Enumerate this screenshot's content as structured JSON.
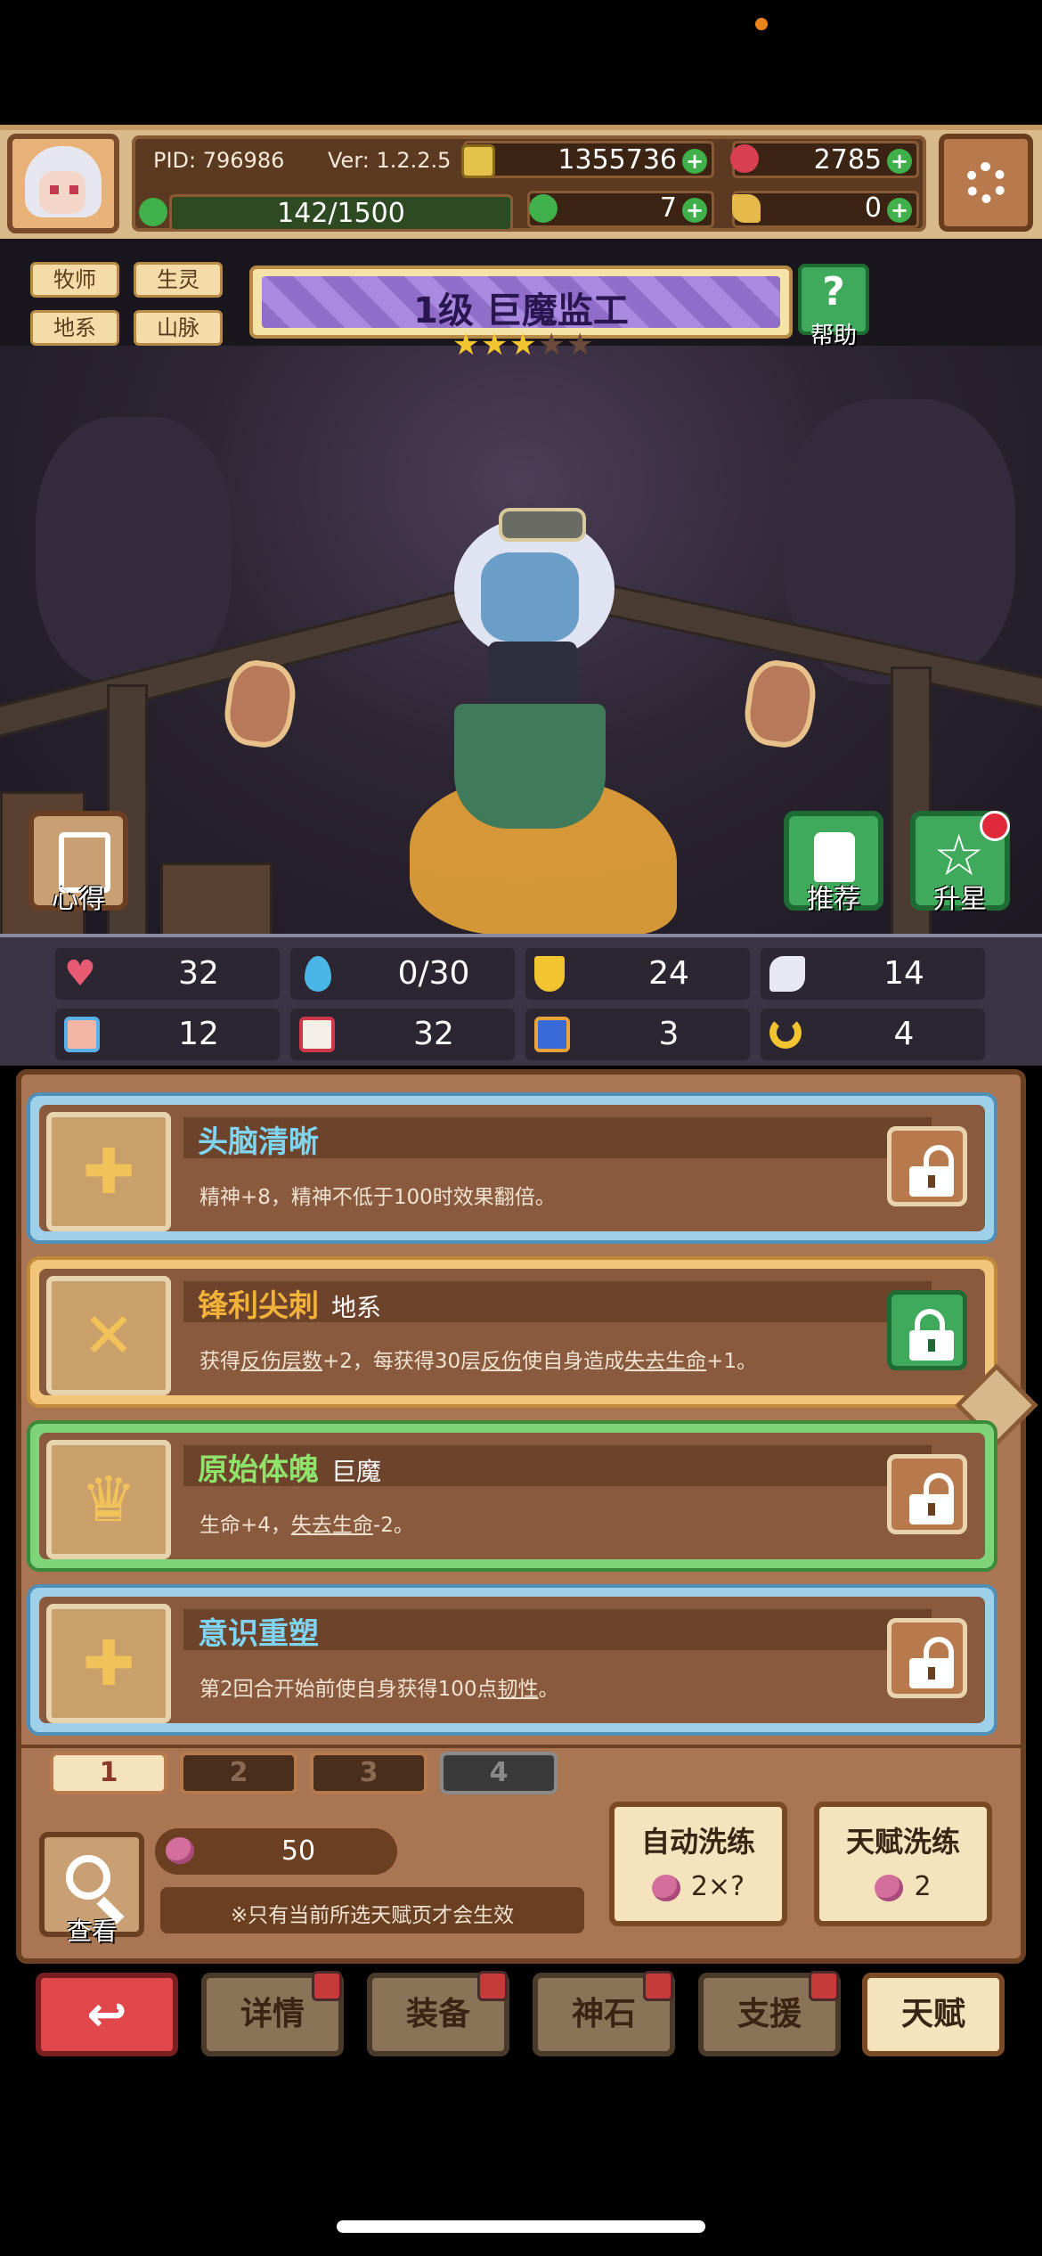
{
  "header": {
    "pid": "PID: 796986",
    "version": "Ver: 1.2.2.5",
    "gold": "1355736",
    "gems": "2785",
    "energy": "142/1500",
    "clover": "7",
    "key": "0"
  },
  "hero": {
    "tags": [
      "牧师",
      "生灵",
      "地系",
      "山脉"
    ],
    "title": "1级 巨魔监工",
    "stars_filled": 3,
    "stars_total": 5,
    "help_label": "帮助",
    "notes_label": "心得",
    "recommend_label": "推荐",
    "upgrade_label": "升星"
  },
  "stats": [
    {
      "icon": "heart-icon",
      "value": "32"
    },
    {
      "icon": "water-drop-icon",
      "value": "0/30"
    },
    {
      "icon": "shield-icon",
      "value": "24"
    },
    {
      "icon": "wing-icon",
      "value": "14"
    },
    {
      "icon": "fist-icon",
      "value": "12"
    },
    {
      "icon": "book-icon",
      "value": "32"
    },
    {
      "icon": "scroll-icon",
      "value": "3"
    },
    {
      "icon": "horseshoe-icon",
      "value": "4"
    }
  ],
  "talents": [
    {
      "name": "头脑清晰",
      "sub": "",
      "desc_parts": [
        "精神+8，精神不低于100时效果翻倍。"
      ],
      "locked": false
    },
    {
      "name": "锋利尖刺",
      "sub": "地系",
      "desc_parts": [
        "获得",
        "反伤层数",
        "+2，每获得30层",
        "反伤",
        "使自身造成",
        "失去生命",
        "+1。"
      ],
      "locked": true
    },
    {
      "name": "原始体魄",
      "sub": "巨魔",
      "desc_parts": [
        "生命+4，",
        "失去生命",
        "-2。"
      ],
      "locked": false
    },
    {
      "name": "意识重塑",
      "sub": "",
      "desc_parts": [
        "第2回合开始前使自身获得100点",
        "韧性",
        "。"
      ],
      "locked": false
    }
  ],
  "pages": [
    "1",
    "2",
    "3",
    "4"
  ],
  "bottom": {
    "view_label": "查看",
    "cost": "50",
    "note": "※只有当前所选天赋页才会生效",
    "auto_reroll_label": "自动洗练",
    "auto_reroll_cost": "2×?",
    "reroll_label": "天赋洗练",
    "reroll_cost": "2"
  },
  "nav": {
    "back_icon": "back-arrow-icon",
    "items": [
      "详情",
      "装备",
      "神石",
      "支援",
      "天赋"
    ]
  }
}
